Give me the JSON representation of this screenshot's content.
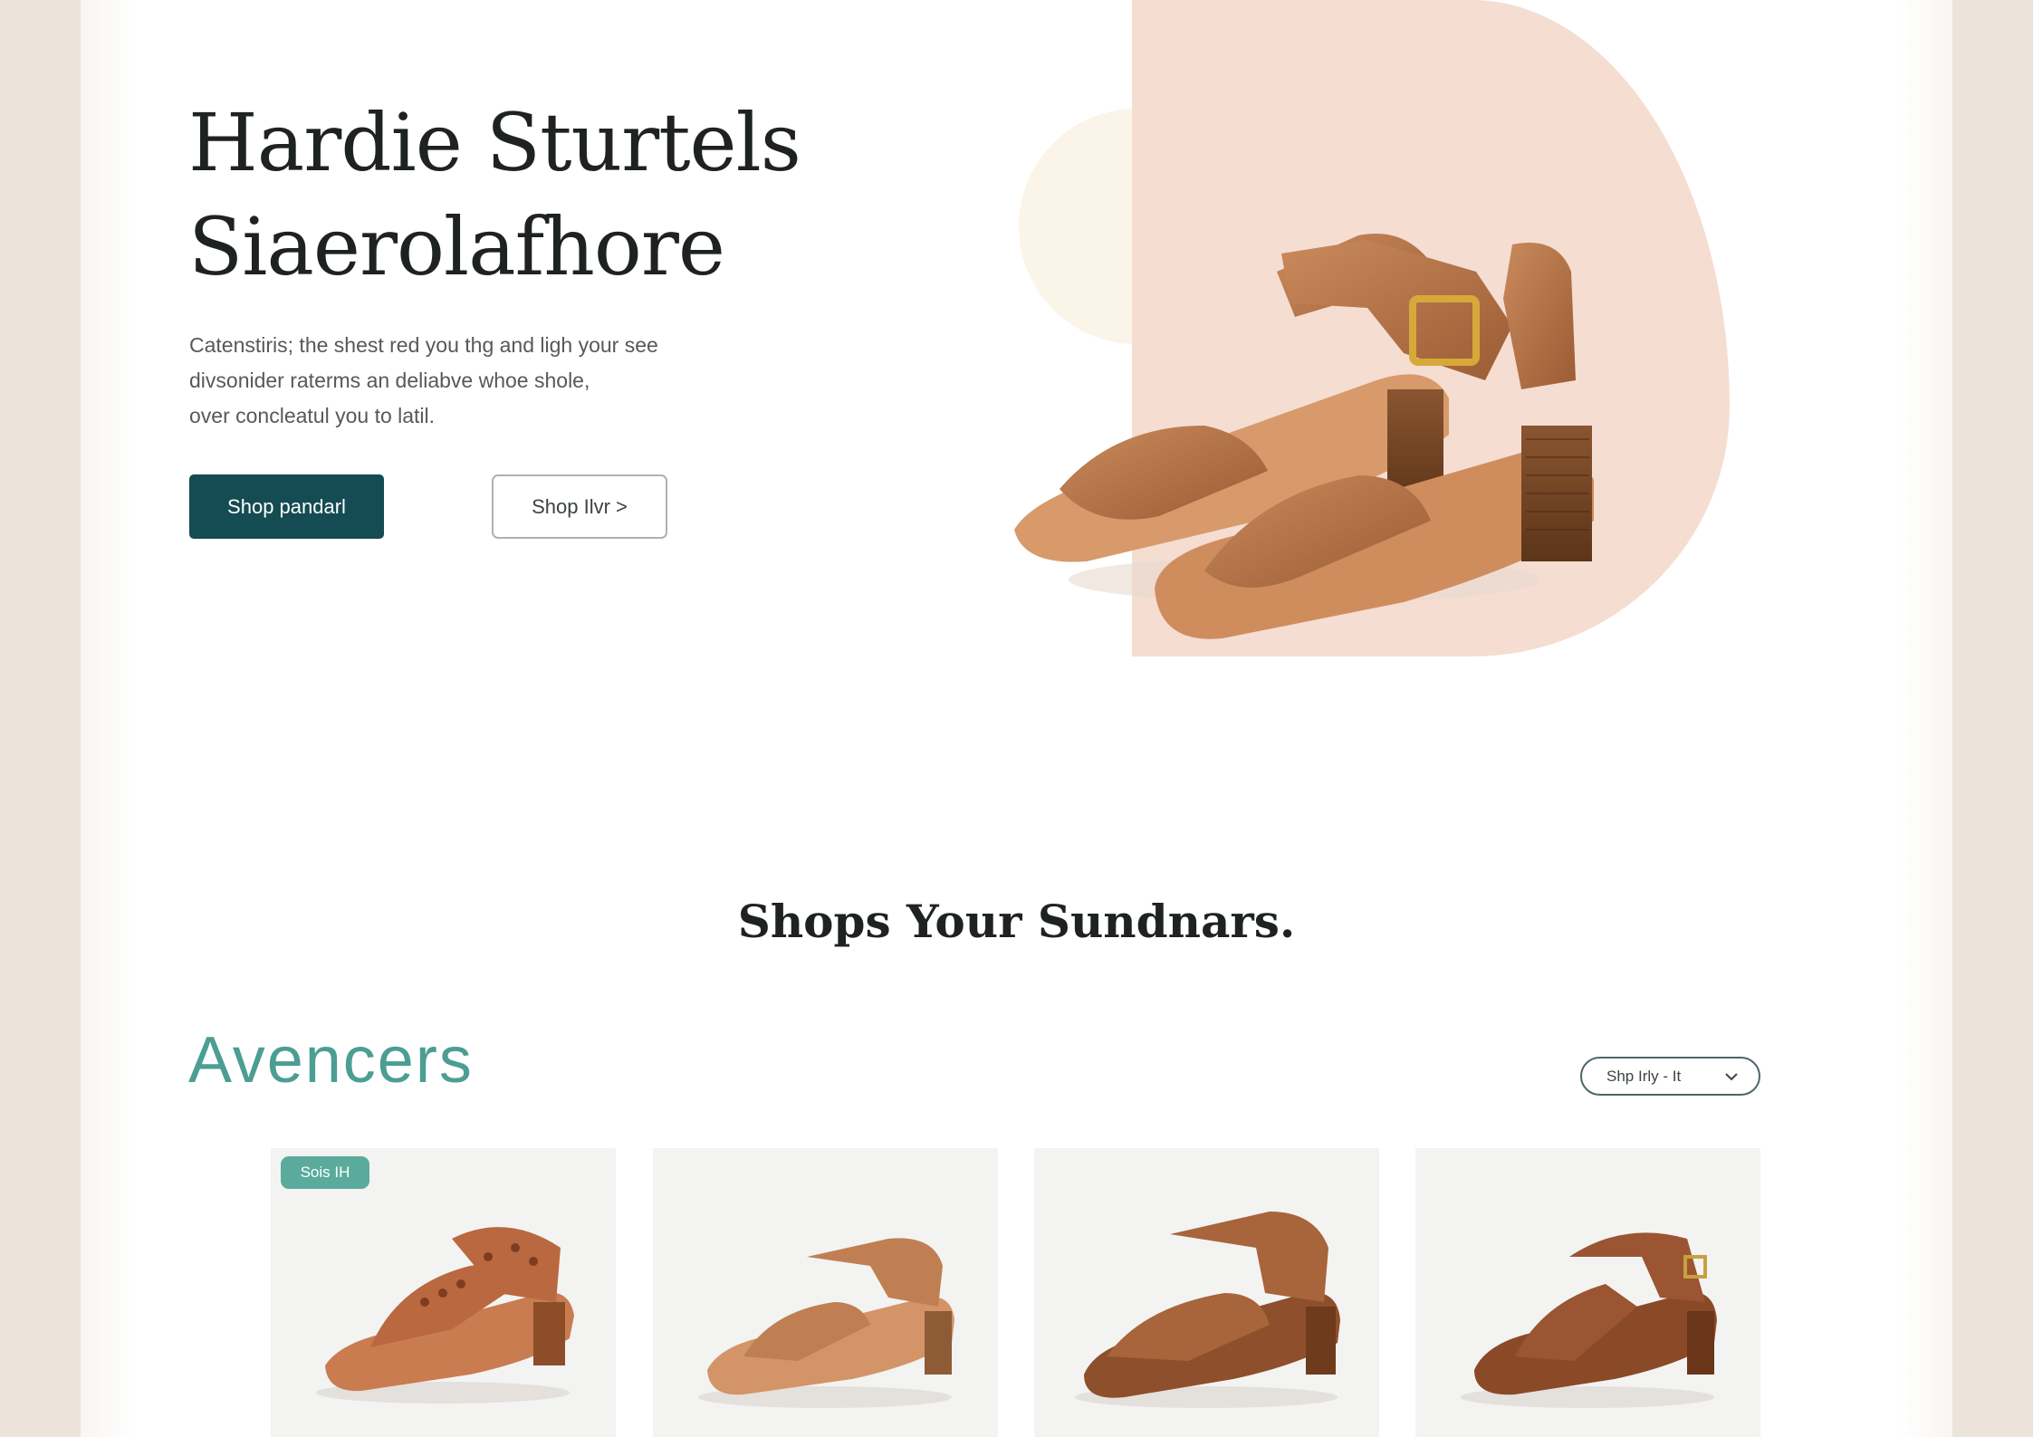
{
  "hero": {
    "title_lines": [
      "Hardie Sturtels",
      "Siaerolafhore"
    ],
    "description_lines": [
      "Catenstiris; the shest red you thg and ligh your see",
      "divsonider raterms an deliabve whoe shole,",
      "over concleatul you to latil."
    ],
    "primary_button": "Shop pandarl",
    "secondary_button": "Shop Ilvr >"
  },
  "section_title": "Shops Your Sundnars.",
  "category": {
    "title": "Avencers",
    "sort_label": "Shp Irly - It",
    "sort_icon": "chevron-down-icon"
  },
  "products": [
    {
      "badge": "Sois IH",
      "color": "#b9683f"
    },
    {
      "color": "#c07f52"
    },
    {
      "color": "#a8643a"
    },
    {
      "color": "#9b5532"
    }
  ],
  "colors": {
    "accent": "#154b52",
    "teal": "#4c9e92",
    "badge": "#5bab9c",
    "blush": "#f5ddd2",
    "sandal_brown": "#b8764a",
    "background": "#ece4da"
  }
}
